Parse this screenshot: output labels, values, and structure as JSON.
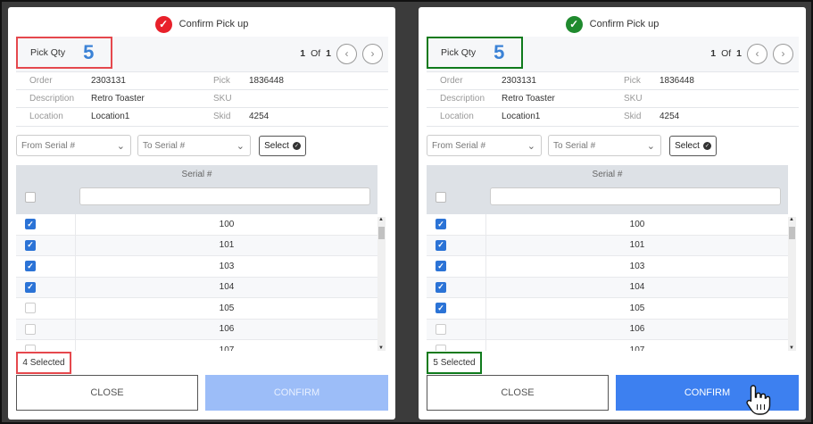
{
  "panels": [
    {
      "header": {
        "title": "Confirm Pick up",
        "status_icon": "x-circle-icon",
        "status_color": "#e8202a"
      },
      "pick_qty": {
        "label": "Pick Qty",
        "value": "5"
      },
      "pager": {
        "current": "1",
        "of_label": "Of",
        "total": "1"
      },
      "info": {
        "order_label": "Order",
        "order_value": "2303131",
        "pick_label": "Pick",
        "pick_value": "1836448",
        "description_label": "Description",
        "description_value": "Retro Toaster",
        "sku_label": "SKU",
        "sku_value": "",
        "location_label": "Location",
        "location_value": "Location1",
        "skid_label": "Skid",
        "skid_value": "4254"
      },
      "filters": {
        "from_placeholder": "From Serial #",
        "to_placeholder": "To Serial #",
        "select_label": "Select"
      },
      "grid": {
        "column_title": "Serial #",
        "rows": [
          {
            "serial": "100",
            "checked": true
          },
          {
            "serial": "101",
            "checked": true
          },
          {
            "serial": "103",
            "checked": true
          },
          {
            "serial": "104",
            "checked": true
          },
          {
            "serial": "105",
            "checked": false
          },
          {
            "serial": "106",
            "checked": false
          },
          {
            "serial": "107",
            "checked": false
          }
        ]
      },
      "selected_count": "4 Selected",
      "close_label": "CLOSE",
      "confirm_label": "CONFIRM",
      "confirm_enabled": false
    },
    {
      "header": {
        "title": "Confirm Pick up",
        "status_icon": "check-circle-icon",
        "status_color": "#1f8a2e"
      },
      "pick_qty": {
        "label": "Pick Qty",
        "value": "5"
      },
      "pager": {
        "current": "1",
        "of_label": "Of",
        "total": "1"
      },
      "info": {
        "order_label": "Order",
        "order_value": "2303131",
        "pick_label": "Pick",
        "pick_value": "1836448",
        "description_label": "Description",
        "description_value": "Retro Toaster",
        "sku_label": "SKU",
        "sku_value": "",
        "location_label": "Location",
        "location_value": "Location1",
        "skid_label": "Skid",
        "skid_value": "4254"
      },
      "filters": {
        "from_placeholder": "From Serial #",
        "to_placeholder": "To Serial #",
        "select_label": "Select"
      },
      "grid": {
        "column_title": "Serial #",
        "rows": [
          {
            "serial": "100",
            "checked": true
          },
          {
            "serial": "101",
            "checked": true
          },
          {
            "serial": "103",
            "checked": true
          },
          {
            "serial": "104",
            "checked": true
          },
          {
            "serial": "105",
            "checked": true
          },
          {
            "serial": "106",
            "checked": false
          },
          {
            "serial": "107",
            "checked": false
          }
        ]
      },
      "selected_count": "5 Selected",
      "close_label": "CLOSE",
      "confirm_label": "CONFIRM",
      "confirm_enabled": true
    }
  ]
}
